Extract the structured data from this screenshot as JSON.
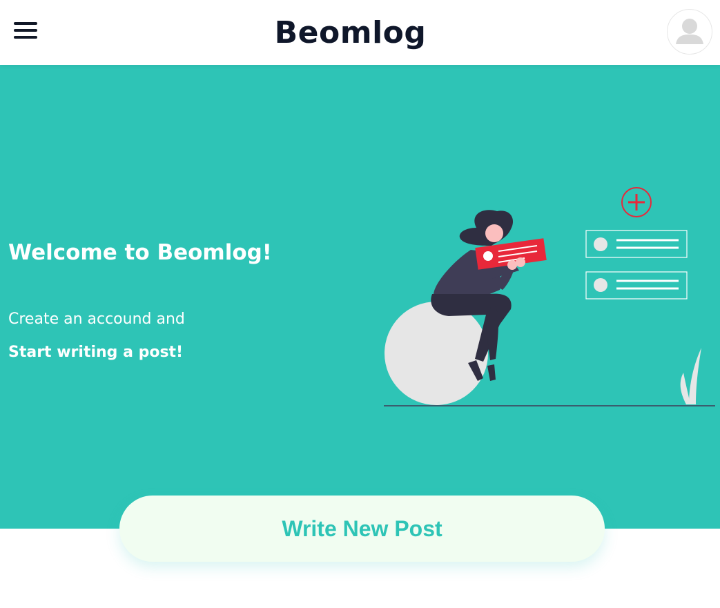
{
  "header": {
    "brand": "Beomlog",
    "menu_icon": "hamburger-menu-icon",
    "avatar_icon": "user-avatar-icon"
  },
  "hero": {
    "title": "Welcome to Beomlog!",
    "line1": "Create an accound and",
    "line2": "Start writing a post!",
    "illustration": "woman-sitting-on-ball-holding-card-illustration"
  },
  "actions": {
    "write_label": "Write New Post"
  },
  "colors": {
    "accent": "#2ec4b6",
    "header_text": "#0f172a",
    "button_bg": "#f1fdf1",
    "illustration_red": "#e8283a",
    "illustration_dark": "#2f2e41"
  }
}
